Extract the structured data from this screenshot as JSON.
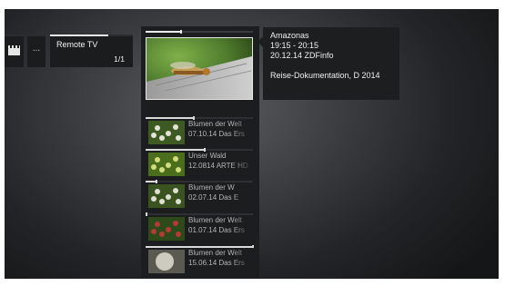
{
  "tiles": {
    "dots_label": "...",
    "remote": {
      "title": "Remote TV",
      "count": "1/1"
    }
  },
  "current": {
    "progress": 0.33,
    "icon": "dragonfly-thumbnail"
  },
  "info": {
    "title": "Amazonas",
    "time": "19:15 - 20:15",
    "date_channel": "20.12.14  ZDFinfo",
    "description": "Reise-Dokumentation, D 2014"
  },
  "recordings": [
    {
      "title": "Blumen der Welt",
      "subtitle": "07.10.14 Das Ers",
      "progress": 0.45,
      "thumb": "daisies-thumbnail"
    },
    {
      "title": "Unser Wald",
      "subtitle": "12.0814 ARTE HD",
      "progress": 0.55,
      "thumb": "forest-flowers-thumbnail"
    },
    {
      "title": "Blumen der W",
      "subtitle": "02.07.14 Das E",
      "progress": 0.1,
      "thumb": "white-blossoms-thumbnail"
    },
    {
      "title": "Blumen der Welt",
      "subtitle": "01.07.14 Das Ers",
      "progress": 0.0,
      "thumb": "red-flower-thumbnail"
    },
    {
      "title": "Blumen der Welt",
      "subtitle": "15.06.14 Das Ers",
      "progress": 1.0,
      "thumb": "dandelion-thumbnail"
    }
  ]
}
